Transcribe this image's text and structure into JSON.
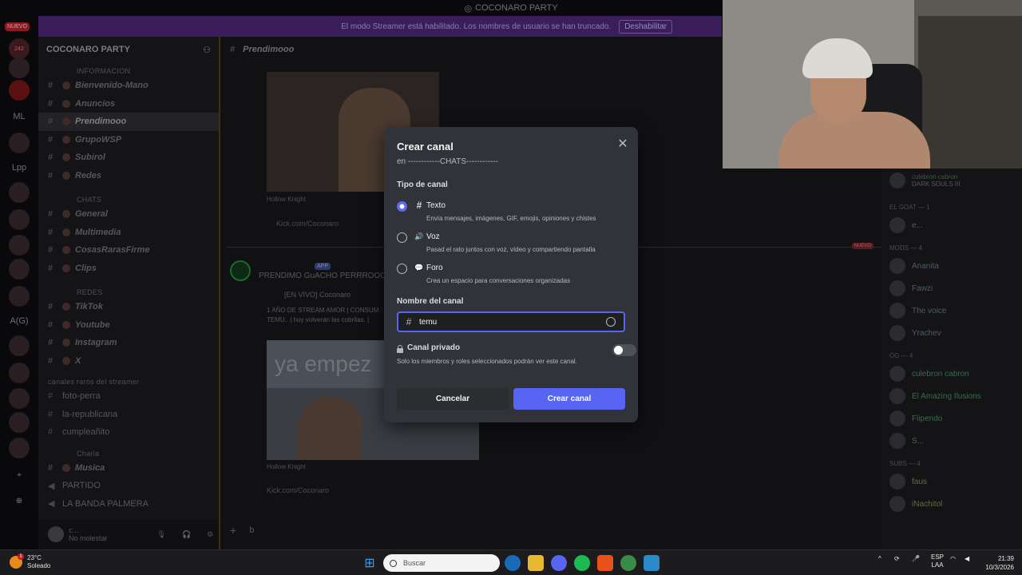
{
  "window": {
    "title": "COCONARO PARTY"
  },
  "banner": {
    "text": "El modo Streamer está habilitado. Los nombres de usuario se han truncado.",
    "button": "Deshabilitar"
  },
  "rail": {
    "badge": "NUEVO",
    "count": "242",
    "ml": "ML",
    "lpp": "Lpp",
    "ag": "A(G)"
  },
  "server": {
    "name": "COCONARO PARTY"
  },
  "categories": {
    "info": "INFORMACION",
    "chats": "CHATS",
    "redes": "REDES",
    "raros": "canales raros del streamer",
    "charla": "Charla"
  },
  "channels": {
    "info": [
      "Bienvenido-Mano",
      "Anuncios",
      "Prendimooo",
      "GrupoWSP",
      "Subirol",
      "Redes"
    ],
    "chats": [
      "General",
      "Multimedia",
      "CosasRarasFirme",
      "Clips"
    ],
    "redes": [
      "TikTok",
      "Youtube",
      "Instagram",
      "X"
    ],
    "raros": [
      "foto-perra",
      "la-republicana",
      "cumpleañito"
    ],
    "charla": [
      "Musica",
      "PARTIDO",
      "LA BANDA PALMERA"
    ]
  },
  "userpanel": {
    "name": "c...",
    "status": "No molestar"
  },
  "chat": {
    "channel": "Prendimooo",
    "caption1": "Hollow Knight",
    "link1": "Kick.com/Coconaro",
    "nuevo": "NUEVO",
    "app_tag": "APP",
    "msg_line": "PRENDIMO GuACHO PERRROOOO",
    "embed_title": "[EN VIVO] Coconaro",
    "embed_desc_1": "1 AÑO DE STREAM AMOR | CONSUM",
    "embed_desc_2": "TEMU.. | hoy volverán las cobritas. |",
    "overlay_text": "ya empez",
    "caption2": "Hollow Knight",
    "link2": "Kick.com/Coconaro",
    "composer": "b"
  },
  "members": {
    "top_name": "culebron cabron",
    "top_game": "DARK SOULS III",
    "groups": [
      "EL GOAT — 1",
      "MODS — 4",
      "OG — 4",
      "SUBS — 4"
    ],
    "goat": [
      "e..."
    ],
    "mods": [
      "Ananita",
      "Fawzi",
      "The voice",
      "Yrachev"
    ],
    "og": [
      "culebron cabron",
      "El Amazing Ilusions",
      "Flipendo",
      "S..."
    ],
    "subs": [
      "faus",
      "iNachitol"
    ]
  },
  "modal": {
    "title": "Crear canal",
    "subtitle": "en ------------CHATS------------",
    "type_label": "Tipo de canal",
    "options": [
      {
        "name": "Texto",
        "desc": "Envía mensajes, imágenes, GIF, emojis, opiniones y chistes",
        "icon": "#"
      },
      {
        "name": "Voz",
        "desc": "Pasad el rato juntos con voz, vídeo y compartiendo pantalla",
        "icon": "🔊"
      },
      {
        "name": "Foro",
        "desc": "Crea un espacio para conversaciones organizadas",
        "icon": "💬"
      }
    ],
    "selected": 0,
    "name_label": "Nombre del canal",
    "name_value": "temu",
    "private_label": "Canal privado",
    "private_desc": "Solo los miembros y roles seleccionados podrán ver este canal.",
    "private_on": false,
    "cancel": "Cancelar",
    "create": "Crear canal"
  },
  "taskbar": {
    "weather_temp": "23°C",
    "weather_desc": "Soleado",
    "weather_badge": "1",
    "search_placeholder": "Buscar",
    "lang_1": "ESP",
    "lang_2": "LAA",
    "time": "21:39",
    "date": "10/3/2026"
  }
}
